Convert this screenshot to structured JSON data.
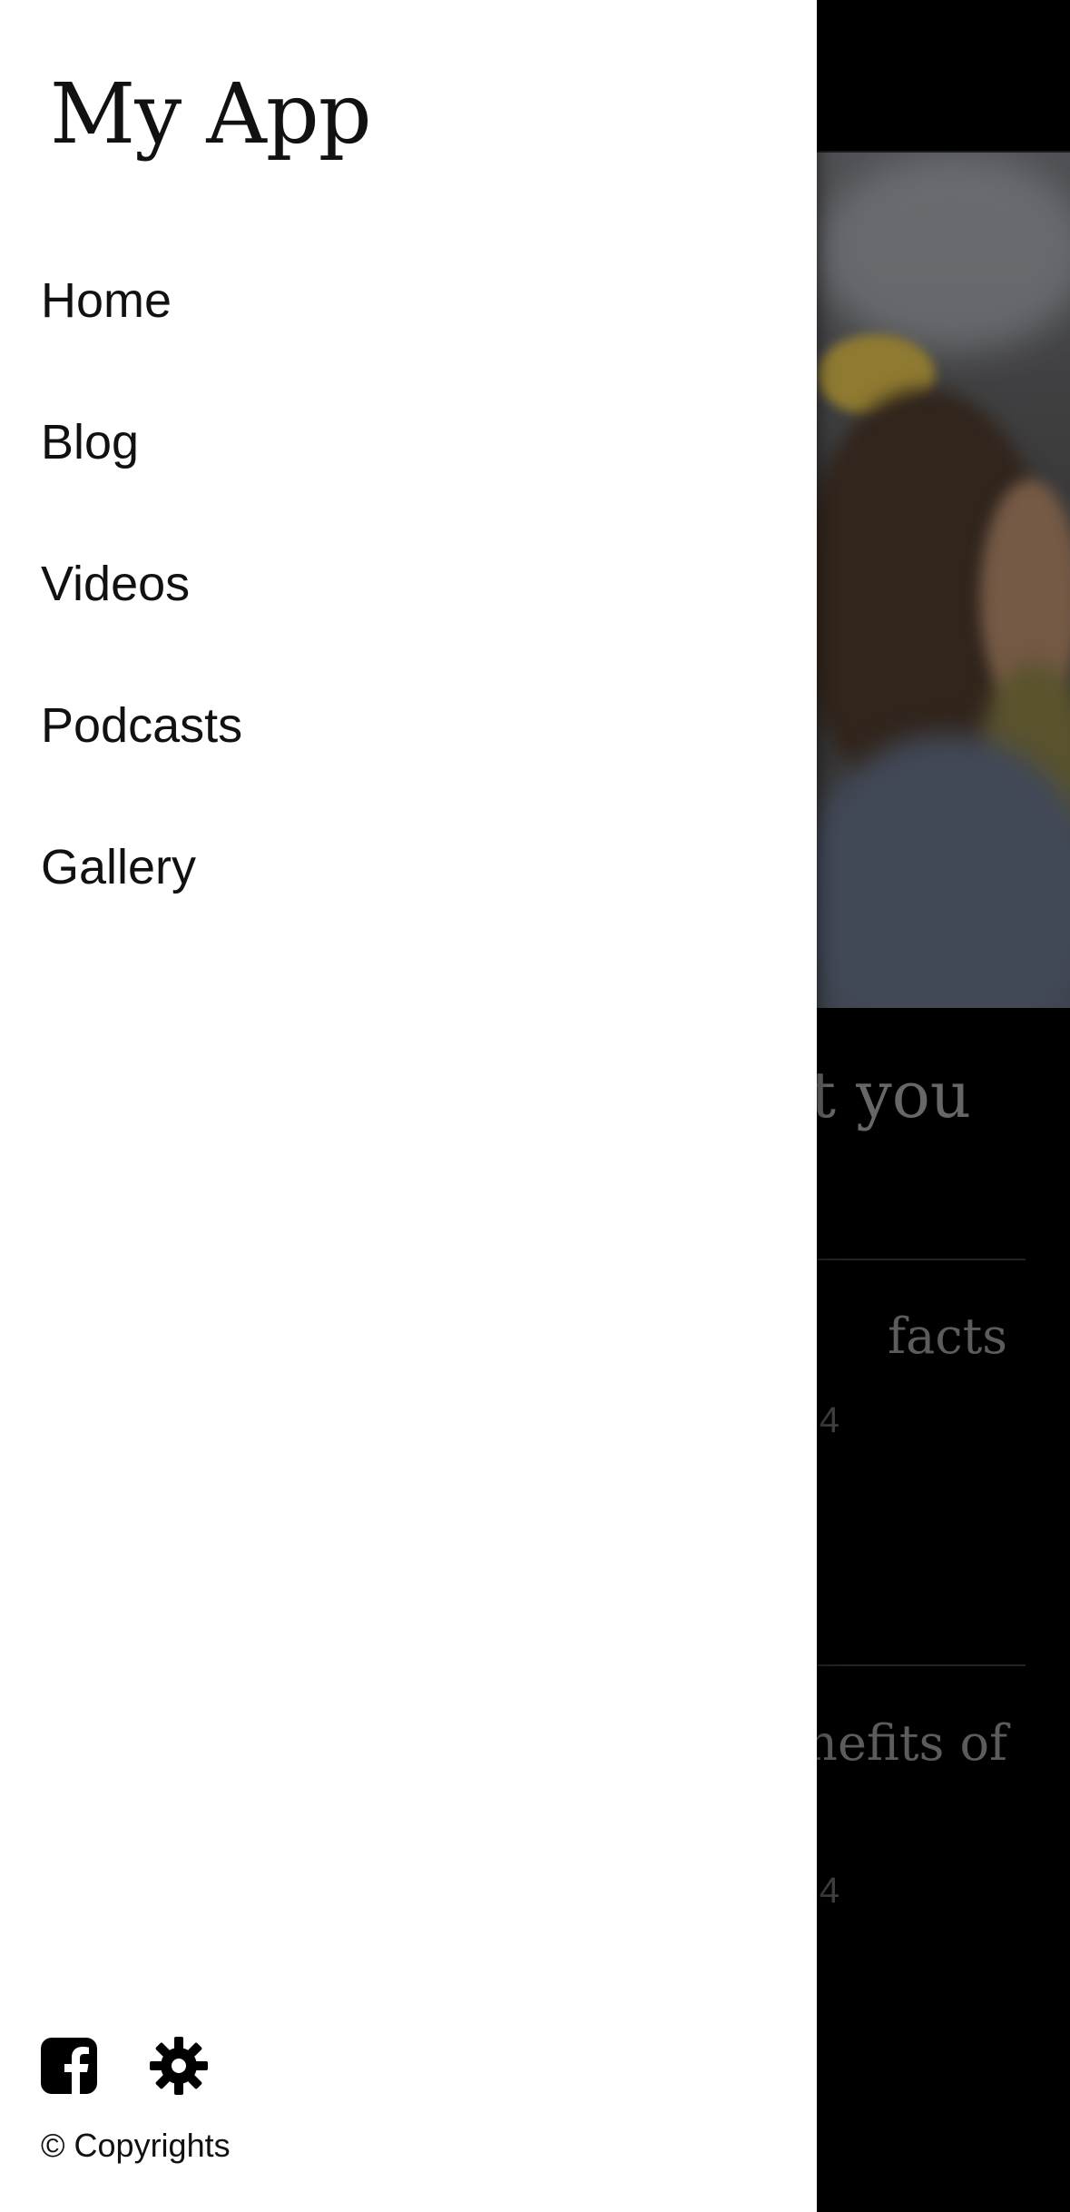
{
  "drawer": {
    "app_title": "My App",
    "nav_items": [
      {
        "label": "Home"
      },
      {
        "label": "Blog"
      },
      {
        "label": "Videos"
      },
      {
        "label": "Podcasts"
      },
      {
        "label": "Gallery"
      }
    ],
    "footer": {
      "icons": [
        "facebook-icon",
        "gear-icon"
      ],
      "copyright": "© Copyrights"
    }
  },
  "background_page": {
    "section_title_visible": "ut you",
    "posts": [
      {
        "title_visible": "facts",
        "date_visible": "4"
      },
      {
        "title_visible": "enefits of",
        "date_visible": "4"
      }
    ]
  },
  "colors": {
    "drawer_background": "#ffffff",
    "text": "#111111",
    "overlay_background": "#000000",
    "dimmed_text": "#7a7a7a"
  }
}
